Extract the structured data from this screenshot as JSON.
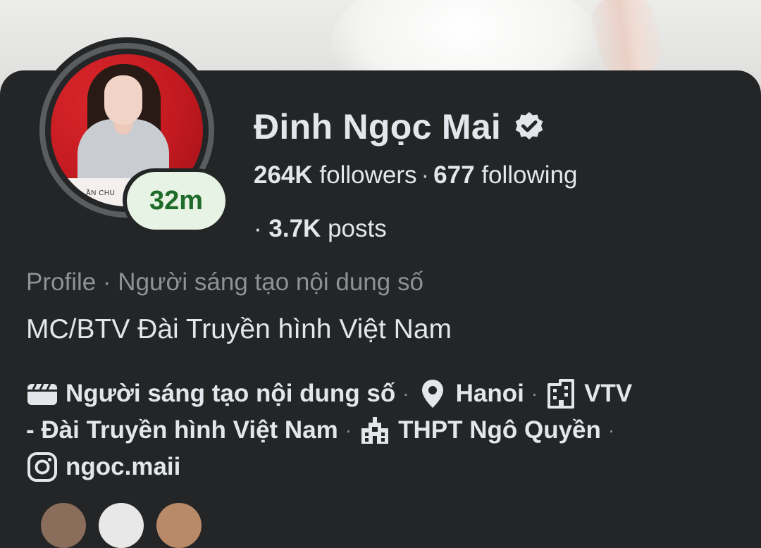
{
  "profile": {
    "name": "Đinh Ngọc Mai",
    "status_badge": "32m",
    "avatar_banner_text": "ẦN CHU",
    "followers_count": "264K",
    "followers_label": "followers",
    "following_count": "677",
    "following_label": "following",
    "posts_count": "3.7K",
    "posts_label": "posts",
    "category": "Profile · Người sáng tạo nội dung số",
    "bio": "MC/BTV Đài Truyền hình Việt Nam"
  },
  "details": {
    "creator_label": "Người sáng tạo nội dung số",
    "location": "Hanoi",
    "work_part1": "VTV",
    "work_part2": "- Đài Truyền hình Việt Nam",
    "education": "THPT Ngô Quyền",
    "instagram": "ngoc.maii"
  },
  "icons": {
    "verified": "verified-badge-icon",
    "creator": "clapperboard-icon",
    "location": "location-pin-icon",
    "work": "building-icon",
    "education": "school-icon",
    "instagram": "instagram-icon"
  },
  "colors": {
    "background": "#242526",
    "text_primary": "#e4e6eb",
    "text_secondary": "#8e9196",
    "status_pill_bg": "#e7f3e4",
    "status_pill_text": "#1e6b2a"
  }
}
